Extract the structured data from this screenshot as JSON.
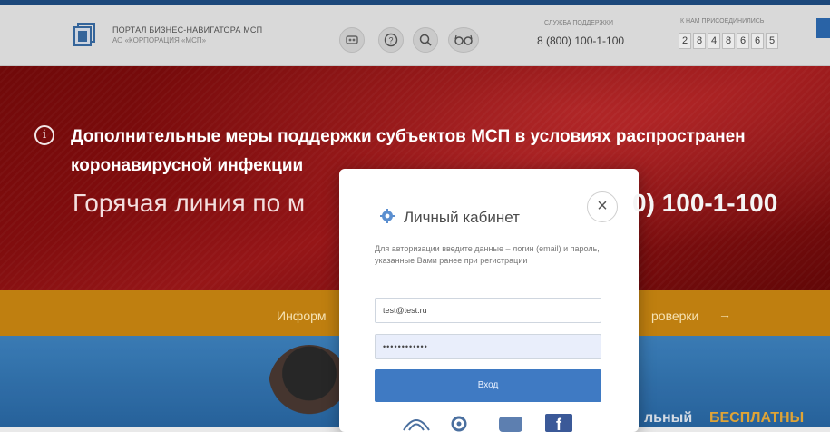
{
  "header": {
    "portal_title": "ПОРТАЛ БИЗНЕС-НАВИГАТОРА МСП",
    "portal_subtitle": "АО «КОРПОРАЦИЯ «МСП»",
    "support_label": "СЛУЖБА ПОДДЕРЖКИ",
    "support_phone": "8 (800) 100-1-100",
    "counter_label": "К НАМ ПРИСОЕДИНИЛИСЬ",
    "counter_digits": [
      "2",
      "8",
      "4",
      "8",
      "6",
      "6",
      "5"
    ],
    "icons": [
      "accessibility-icon",
      "help-icon",
      "search-icon",
      "glasses-icon"
    ]
  },
  "banner": {
    "alert_line1": "Дополнительные меры поддержки субъектов МСП в условиях распространен",
    "alert_line2": "коронавирусной инфекции",
    "hotline_left": "Горячая линия по м",
    "hotline_right": "0) 100-1-100"
  },
  "orange_bar": {
    "left_text": "Информ",
    "right_text": "роверки",
    "arrow": "→"
  },
  "promo": {
    "prefix": "льный",
    "highlight": "БЕСПЛАТНЫ"
  },
  "modal": {
    "title": "Личный кабинет",
    "close_label": "×",
    "description": "Для авторизации введите данные – логин (email) и пароль, указанные Вами ранее при регистрации",
    "login_value": "test@test.ru",
    "password_value": "••••••••••••",
    "submit_label": "Вход"
  },
  "colors": {
    "brand_blue": "#1f4f86",
    "banner_red": "#8c0f10",
    "orange": "#d08a12",
    "button_blue": "#3f7ac3"
  }
}
